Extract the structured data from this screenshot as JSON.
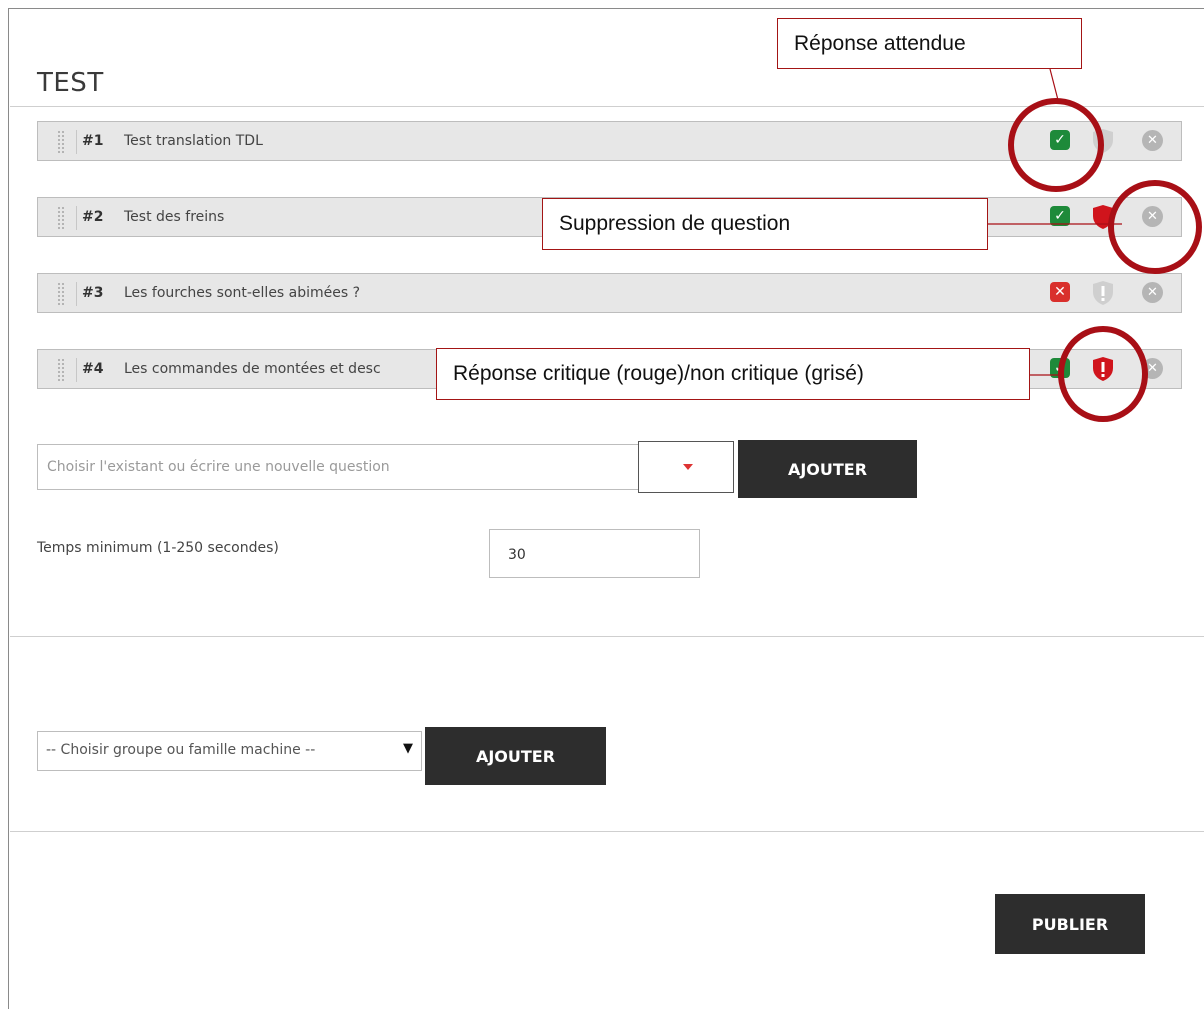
{
  "page": {
    "title": "TEST"
  },
  "questions": [
    {
      "number": "#1",
      "text": "Test translation TDL",
      "expected": "check",
      "critical": false
    },
    {
      "number": "#2",
      "text": "Test des freins",
      "expected": "check",
      "critical": true
    },
    {
      "number": "#3",
      "text": "Les fourches sont-elles abimées ?",
      "expected": "cross",
      "critical": false
    },
    {
      "number": "#4",
      "text": "Les commandes de montées et desc",
      "expected": "check",
      "critical": true
    }
  ],
  "glyphs": {
    "check": "✓",
    "cross": "✕",
    "delete": "✕",
    "exclamation": "!"
  },
  "add_question": {
    "placeholder": "Choisir l'existant ou écrire une nouvelle question",
    "button_label": "AJOUTER"
  },
  "min_time": {
    "label": "Temps minimum (1-250 secondes)",
    "value": "30"
  },
  "group": {
    "select_label": "-- Choisir groupe ou famille machine --",
    "select_arrow": "▼",
    "button_label": "AJOUTER"
  },
  "publish": {
    "button_label": "PUBLIER"
  },
  "annotations": {
    "expected_answer": "Réponse attendue",
    "delete_question": "Suppression de question",
    "critical_answer": "Réponse critique (rouge)/non critique (grisé)"
  },
  "colors": {
    "check_green": "#1e8a3a",
    "cross_red": "#d9302c",
    "critical_red": "#d0141c",
    "non_critical_grey": "#cfcfcf",
    "annotation_red": "#a80f16"
  }
}
